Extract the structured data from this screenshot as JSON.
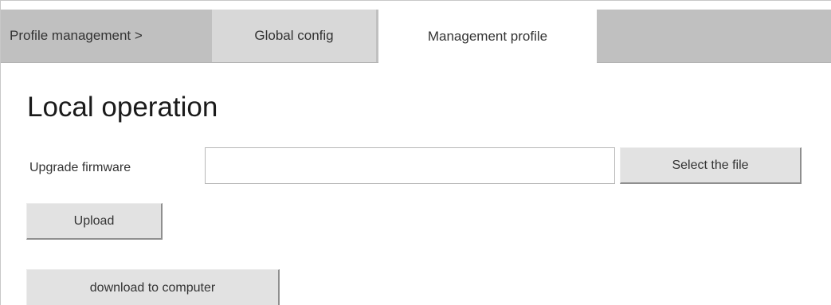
{
  "tabs": {
    "breadcrumb": "Profile management >",
    "global_config": "Global config",
    "management_profile": "Management profile"
  },
  "main": {
    "title": "Local operation",
    "upgrade_label": "Upgrade firmware",
    "file_value": "",
    "select_button": "Select the file",
    "upload_button": "Upload",
    "download_button": "download to computer"
  },
  "colors": {
    "tabbar_bg": "#c0c0c0",
    "inactive_tab_bg": "#d8d8d8",
    "active_tab_bg": "#ffffff",
    "button_bg": "#e2e2e2"
  }
}
